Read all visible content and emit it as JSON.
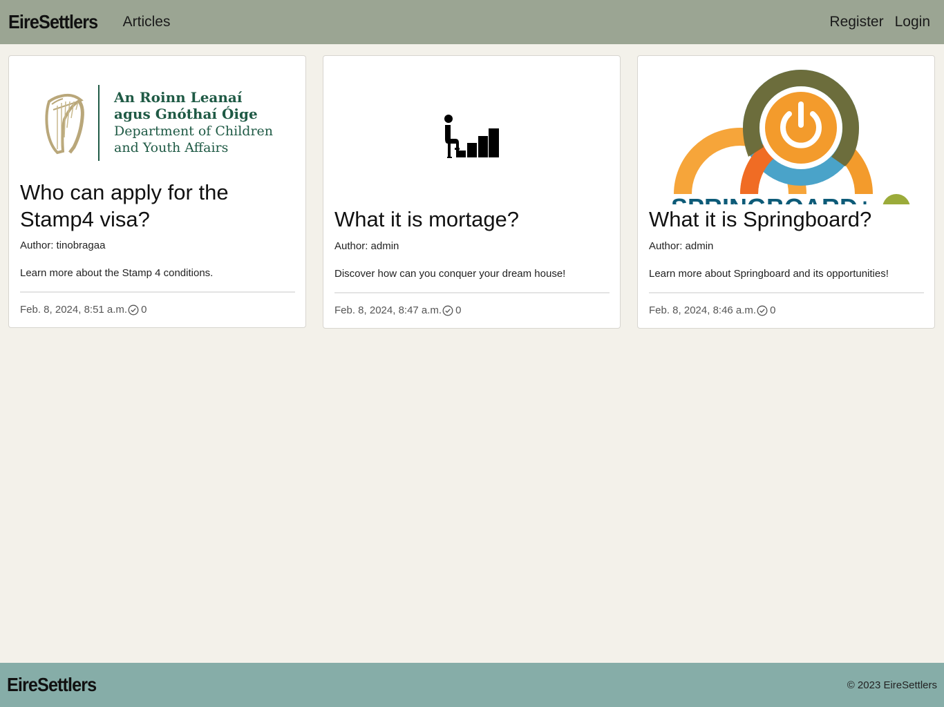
{
  "navbar": {
    "brand": "EireSettlers",
    "links": [
      "Articles"
    ],
    "auth_links": [
      "Register",
      "Login"
    ]
  },
  "articles": [
    {
      "title": "Who can apply for the Stamp4 visa?",
      "author": "Author: tinobragaa",
      "excerpt": "Learn more about the Stamp 4 conditions.",
      "date": "Feb. 8, 2024, 8:51 a.m.",
      "count": "0",
      "image_logo": {
        "line1": "An Roinn Leanaí",
        "line2": "agus Gnóthaí Óige",
        "line3": "Department of Children",
        "line4": "and Youth Affairs"
      },
      "image_icon": "harp-icon"
    },
    {
      "title": "What it is mortage?",
      "author": "Author: admin",
      "excerpt": "Discover how can you conquer your dream house!",
      "date": "Feb. 8, 2024, 8:47 a.m.",
      "count": "0",
      "image_icon": "person-climbing-stairs-icon"
    },
    {
      "title": "What it is Springboard?",
      "author": "Author: admin",
      "excerpt": "Learn more about Springboard and its opportunities!",
      "date": "Feb. 8, 2024, 8:46 a.m.",
      "count": "0",
      "image_icon": "springboard-logo",
      "image_logo_text": "SPRINGBOARD+"
    }
  ],
  "footer": {
    "brand": "EireSettlers",
    "copyright": "© 2023 EireSettlers"
  },
  "colors": {
    "navbar": "#9ba593",
    "footer": "#86ada8",
    "page_bg": "#f3f1ea",
    "logo_green": "#1f5a45",
    "springboard_blue": "#4aa3c9",
    "springboard_orange": "#f39b2c",
    "springboard_olive": "#6e6a35"
  }
}
